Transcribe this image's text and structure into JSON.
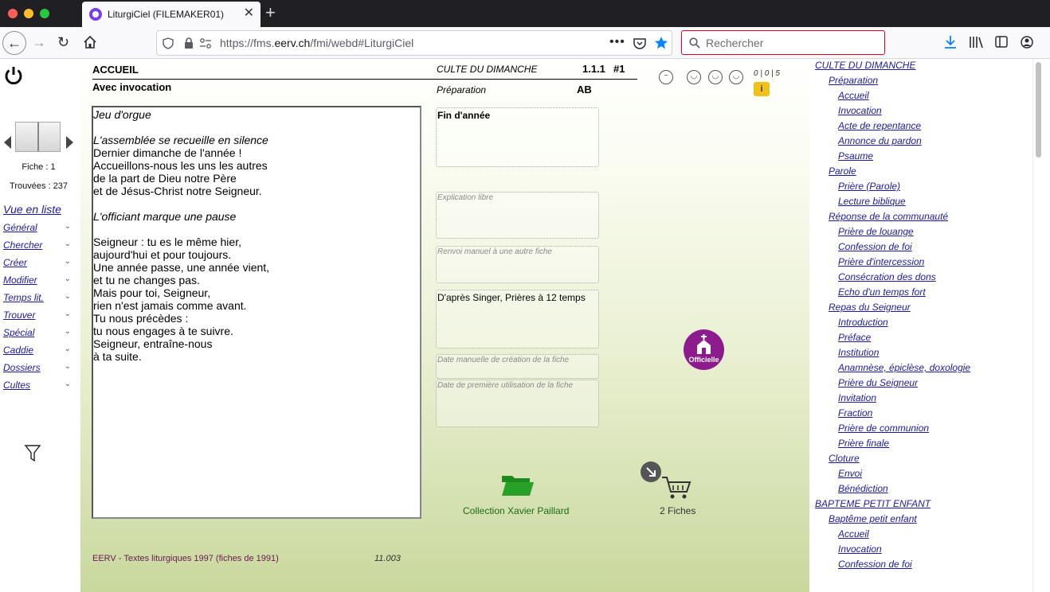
{
  "browser": {
    "tab_title": "LiturgiCiel (FILEMAKER01)",
    "url_prefix": "https://fms.",
    "url_domain": "eerv.ch",
    "url_path": "/fmi/webd#LiturgiCiel",
    "search_placeholder": "Rechercher"
  },
  "sidebar": {
    "fiche_label": "Fiche : 1",
    "trouvees_label": "Trouvées : 237",
    "list_view_link": "Vue en liste",
    "menu": [
      {
        "label": "Général"
      },
      {
        "label": "Chercher"
      },
      {
        "label": "Créer"
      },
      {
        "label": "Modifier"
      },
      {
        "label": "Temps lit."
      },
      {
        "label": "Trouver"
      },
      {
        "label": "Spécial"
      },
      {
        "label": "Caddie"
      },
      {
        "label": "Dossiers"
      },
      {
        "label": "Cultes"
      }
    ]
  },
  "record": {
    "section_title": "ACCUEIL",
    "subtitle": "Avec invocation",
    "culte": "CULTE DU DIMANCHE",
    "number": "1.1.1",
    "hash": "#1",
    "phase": "Préparation",
    "initials": "AB",
    "rating": "0 | 0 | 5",
    "info_badge": "i",
    "text_lines": [
      {
        "text": "Jeu d'orgue",
        "italic": true
      },
      {
        "text": "",
        "italic": false
      },
      {
        "text": "L'assemblée se recueille en silence",
        "italic": true
      },
      {
        "text": "Dernier dimanche de l'année !",
        "italic": false
      },
      {
        "text": "Accueillons-nous les uns les autres",
        "italic": false
      },
      {
        "text": "de la part de Dieu notre Père",
        "italic": false
      },
      {
        "text": "et de Jésus-Christ notre Seigneur.",
        "italic": false
      },
      {
        "text": "",
        "italic": false
      },
      {
        "text": "L'officiant marque une pause",
        "italic": true
      },
      {
        "text": "",
        "italic": false
      },
      {
        "text": "Seigneur : tu es le même hier,",
        "italic": false
      },
      {
        "text": "aujourd'hui et pour toujours.",
        "italic": false
      },
      {
        "text": "Une année passe, une année vient,",
        "italic": false
      },
      {
        "text": "et tu ne changes pas.",
        "italic": false
      },
      {
        "text": "Mais pour toi, Seigneur,",
        "italic": false
      },
      {
        "text": "rien n'est jamais comme avant.",
        "italic": false
      },
      {
        "text": "Tu nous précèdes :",
        "italic": false
      },
      {
        "text": "tu nous engages à te suivre.",
        "italic": false
      },
      {
        "text": "Seigneur, entraîne-nous",
        "italic": false
      },
      {
        "text": "à ta suite.",
        "italic": false
      }
    ],
    "fields": {
      "occasion": "Fin d'année",
      "explication_placeholder": "Explication libre",
      "renvoi_placeholder": "Renvoi manuel à une autre fiche",
      "source": "D'après Singer, Prières à 12 temps",
      "date_creation_placeholder": "Date manuelle de création de la fiche",
      "date_usage_placeholder": "Date de première utilisation de la fiche"
    },
    "officielle_label": "Officielle",
    "collection_label": "Collection Xavier Paillard",
    "cart_label": "2 Fiches",
    "footer_source": "EERV - Textes liturgiques 1997 (fiches de 1991)",
    "footer_code": "11.003"
  },
  "outline": [
    {
      "label": "CULTE DU DIMANCHE",
      "level": 0
    },
    {
      "label": "Préparation",
      "level": 1
    },
    {
      "label": "Accueil",
      "level": 2
    },
    {
      "label": "Invocation",
      "level": 2
    },
    {
      "label": "Acte de repentance",
      "level": 2
    },
    {
      "label": "Annonce du pardon",
      "level": 2
    },
    {
      "label": "Psaume",
      "level": 2
    },
    {
      "label": "Parole",
      "level": 1
    },
    {
      "label": "Prière (Parole)",
      "level": 2
    },
    {
      "label": "Lecture biblique",
      "level": 2
    },
    {
      "label": "Réponse de la communauté",
      "level": 1
    },
    {
      "label": "Prière de louange",
      "level": 2
    },
    {
      "label": "Confession de foi",
      "level": 2
    },
    {
      "label": "Prière d'intercession",
      "level": 2
    },
    {
      "label": "Consécration des dons",
      "level": 2
    },
    {
      "label": "Echo d'un temps fort",
      "level": 2
    },
    {
      "label": "Repas du Seigneur",
      "level": 1
    },
    {
      "label": "Introduction",
      "level": 2
    },
    {
      "label": "Préface",
      "level": 2
    },
    {
      "label": "Institution",
      "level": 2
    },
    {
      "label": "Anamnèse, épiclèse, doxologie",
      "level": 2
    },
    {
      "label": "Prière du Seigneur",
      "level": 2
    },
    {
      "label": "Invitation",
      "level": 2
    },
    {
      "label": "Fraction",
      "level": 2
    },
    {
      "label": "Prière de communion",
      "level": 2
    },
    {
      "label": "Prière finale",
      "level": 2
    },
    {
      "label": "Cloture",
      "level": 1
    },
    {
      "label": "Envoi",
      "level": 2
    },
    {
      "label": "Bénédiction",
      "level": 2
    },
    {
      "label": "BAPTEME PETIT ENFANT",
      "level": 0
    },
    {
      "label": "Baptême petit enfant",
      "level": 1
    },
    {
      "label": "Accueil",
      "level": 2
    },
    {
      "label": "Invocation",
      "level": 2
    },
    {
      "label": "Confession de foi",
      "level": 2
    }
  ],
  "colors": {
    "link": "#1a1aa6",
    "officielle": "#8c1b8e",
    "collection": "#1a6b1a",
    "footer_source": "#6b1a52"
  }
}
